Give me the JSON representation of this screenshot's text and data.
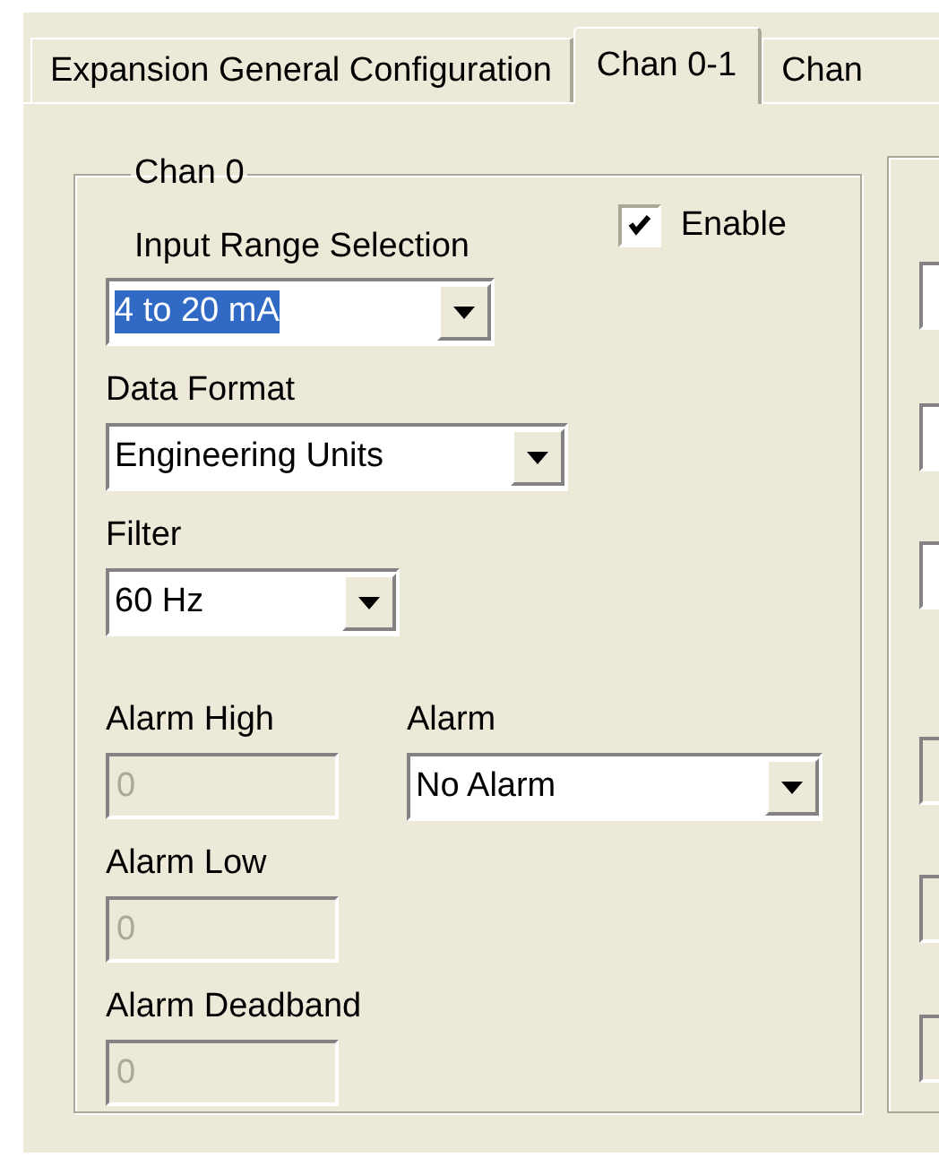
{
  "tabs": [
    {
      "label": "Expansion General Configuration",
      "selected": false
    },
    {
      "label": "Chan 0-1",
      "selected": true
    },
    {
      "label": "Chan",
      "selected": false
    }
  ],
  "group": {
    "title": "Chan 0",
    "enable": {
      "label": "Enable",
      "checked": true
    },
    "input_range": {
      "label": "Input Range Selection",
      "value": "4 to 20 mA",
      "text_selected": true
    },
    "data_format": {
      "label": "Data Format",
      "value": "Engineering Units"
    },
    "filter": {
      "label": "Filter",
      "value": "60 Hz"
    },
    "alarm_limits": [
      {
        "label": "Alarm High",
        "value": "0",
        "disabled": true
      },
      {
        "label": "Alarm Low",
        "value": "0",
        "disabled": true
      },
      {
        "label": "Alarm Deadband",
        "value": "0",
        "disabled": true
      }
    ],
    "alarm": {
      "label": "Alarm",
      "value": "No Alarm"
    }
  }
}
